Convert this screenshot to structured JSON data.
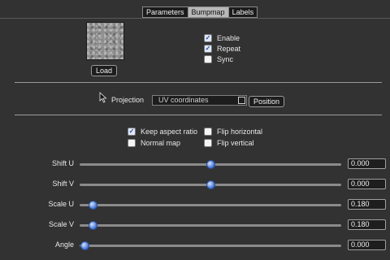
{
  "tabs": [
    {
      "label": "Parameters",
      "active": false
    },
    {
      "label": "Bumpmap",
      "active": true
    },
    {
      "label": "Labels",
      "active": false
    }
  ],
  "texture": {
    "load_label": "Load"
  },
  "options": {
    "enable": {
      "label": "Enable",
      "checked": true
    },
    "repeat": {
      "label": "Repeat",
      "checked": true
    },
    "sync": {
      "label": "Sync",
      "checked": false
    }
  },
  "projection": {
    "label": "Projection",
    "value": "UV coordinates",
    "position_label": "Position"
  },
  "flags": {
    "keep_aspect": {
      "label": "Keep aspect ratio",
      "checked": true
    },
    "flip_horizontal": {
      "label": "Flip horizontal",
      "checked": false
    },
    "normal_map": {
      "label": "Normal map",
      "checked": false
    },
    "flip_vertical": {
      "label": "Flip vertical",
      "checked": false
    }
  },
  "sliders": [
    {
      "label": "Shift U",
      "value": "0.000",
      "level": 0.5
    },
    {
      "label": "Shift V",
      "value": "0.000",
      "level": 0.5
    },
    {
      "label": "Scale U",
      "value": "0.180",
      "level": 0.05
    },
    {
      "label": "Scale V",
      "value": "0.180",
      "level": 0.05
    },
    {
      "label": "Angle",
      "value": "0.000",
      "level": 0.02
    }
  ],
  "colors": {
    "background": "#323232",
    "knob": "#3f6fd0",
    "check": "#2a4a9a"
  }
}
